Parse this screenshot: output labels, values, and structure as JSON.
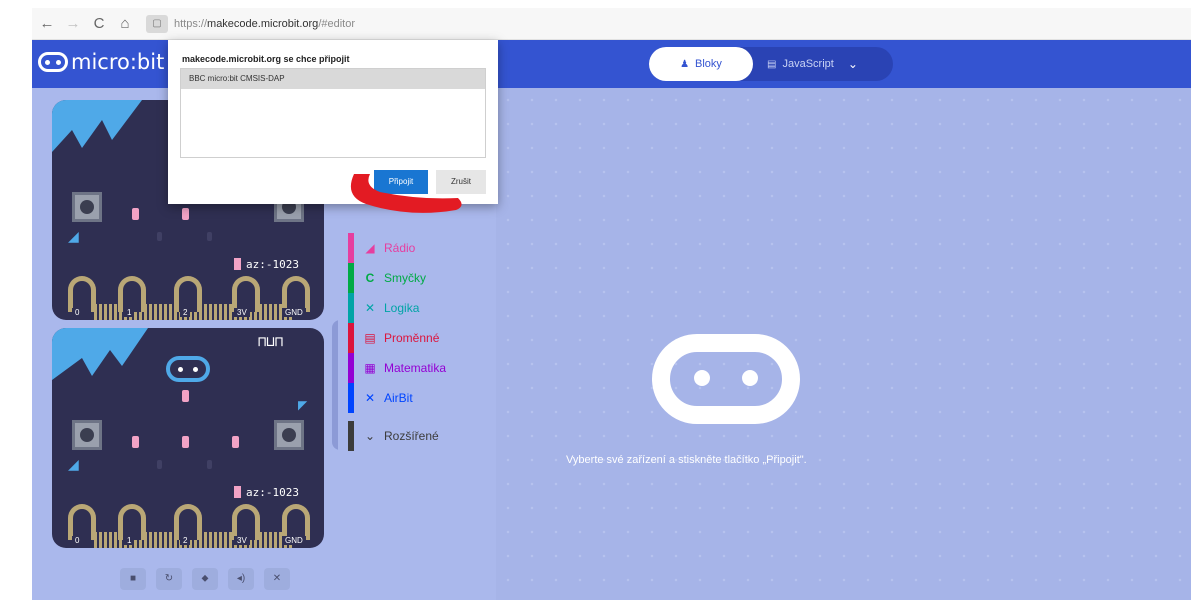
{
  "browser": {
    "back": "←",
    "forward": "→",
    "reload": "C",
    "home": "⌂",
    "lock": "▢",
    "url_prefix": "https://",
    "url_host": "makecode.microbit.org",
    "url_suffix": "/#editor"
  },
  "header": {
    "logo_text": "micro:bit",
    "tab_blocks": "Bloky",
    "tab_js": "JavaScript",
    "tab_chevron": "⌄"
  },
  "simulator": {
    "accel_top": "az:-1023",
    "accel_bottom": "az:-1023",
    "pins": [
      "0",
      "1",
      "2",
      "3V",
      "GND"
    ],
    "toolbar": [
      "■",
      "↻",
      "⬥",
      "◂)",
      "✕"
    ]
  },
  "toolbox": {
    "collapse_icon": "‹",
    "items": [
      {
        "label": "Rádio",
        "icon": "◢",
        "color": "#e63e9f"
      },
      {
        "label": "Smyčky",
        "icon": "C",
        "color": "#00aa45"
      },
      {
        "label": "Logika",
        "icon": "✕",
        "color": "#00a4a6"
      },
      {
        "label": "Proměnné",
        "icon": "▤",
        "color": "#dc143c"
      },
      {
        "label": "Matematika",
        "icon": "▦",
        "color": "#9400d3"
      },
      {
        "label": "AirBit",
        "icon": "✕",
        "color": "#0044ff"
      },
      {
        "label": "Rozšířené",
        "icon": "⌄",
        "color": "#3c3c3c"
      }
    ]
  },
  "workspace": {
    "message": "Vyberte své zařízení a stiskněte tlačítko „Připojit\"."
  },
  "dialog": {
    "title": "makecode.microbit.org se chce připojit",
    "device": "BBC micro:bit CMSIS-DAP",
    "connect": "Připojit",
    "cancel": "Zrušit"
  },
  "colors": {
    "header": "#3454d1",
    "workspace": "#a6b4e8",
    "annotation": "#e31b23"
  }
}
